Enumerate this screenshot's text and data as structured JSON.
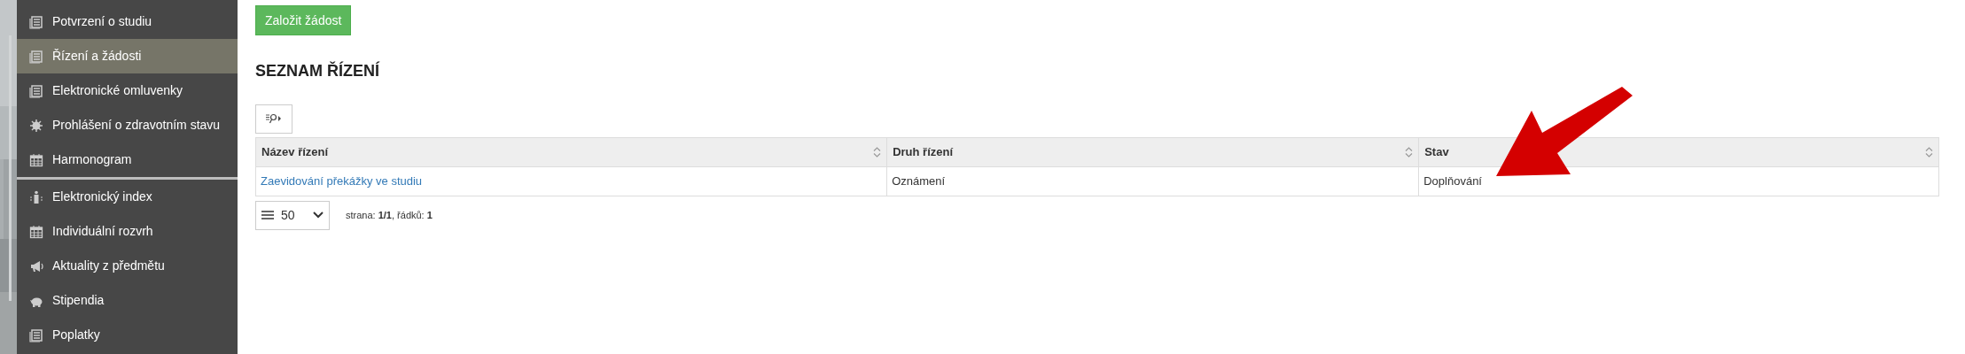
{
  "sidebar": {
    "groups": [
      {
        "items": [
          {
            "label": "Potvrzení o studiu",
            "kind": "document",
            "selected": false
          },
          {
            "label": "Řízení a žádosti",
            "kind": "document",
            "selected": true
          },
          {
            "label": "Elektronické omluvenky",
            "kind": "document",
            "selected": false
          },
          {
            "label": "Prohlášení o zdravotním stavu",
            "kind": "virus",
            "selected": false
          },
          {
            "label": "Harmonogram",
            "kind": "calendar",
            "selected": false
          }
        ]
      },
      {
        "items": [
          {
            "label": "Elektronický index",
            "kind": "info",
            "selected": false
          },
          {
            "label": "Individuální rozvrh",
            "kind": "calendar",
            "selected": false
          },
          {
            "label": "Aktuality z předmětu",
            "kind": "megaphone",
            "selected": false
          },
          {
            "label": "Stipendia",
            "kind": "piggy",
            "selected": false
          },
          {
            "label": "Poplatky",
            "kind": "document",
            "selected": false
          }
        ]
      }
    ]
  },
  "create_button": {
    "label": "Založit žádost"
  },
  "heading": "SEZNAM ŘÍZENÍ",
  "table": {
    "columns": [
      {
        "label": "Název řízení"
      },
      {
        "label": "Druh řízení"
      },
      {
        "label": "Stav"
      }
    ],
    "rows": [
      {
        "cells": [
          {
            "text": "Zaevidování překážky ve studiu",
            "kind": "link"
          },
          {
            "text": "Oznámení",
            "kind": "text"
          },
          {
            "text": "Doplňování",
            "kind": "text"
          }
        ]
      }
    ]
  },
  "pager": {
    "page_size": "50",
    "info": "strana: **1/1**, řádků: **1**"
  },
  "annotations": [
    {
      "kind": "arrow",
      "color": "#d40000"
    }
  ]
}
